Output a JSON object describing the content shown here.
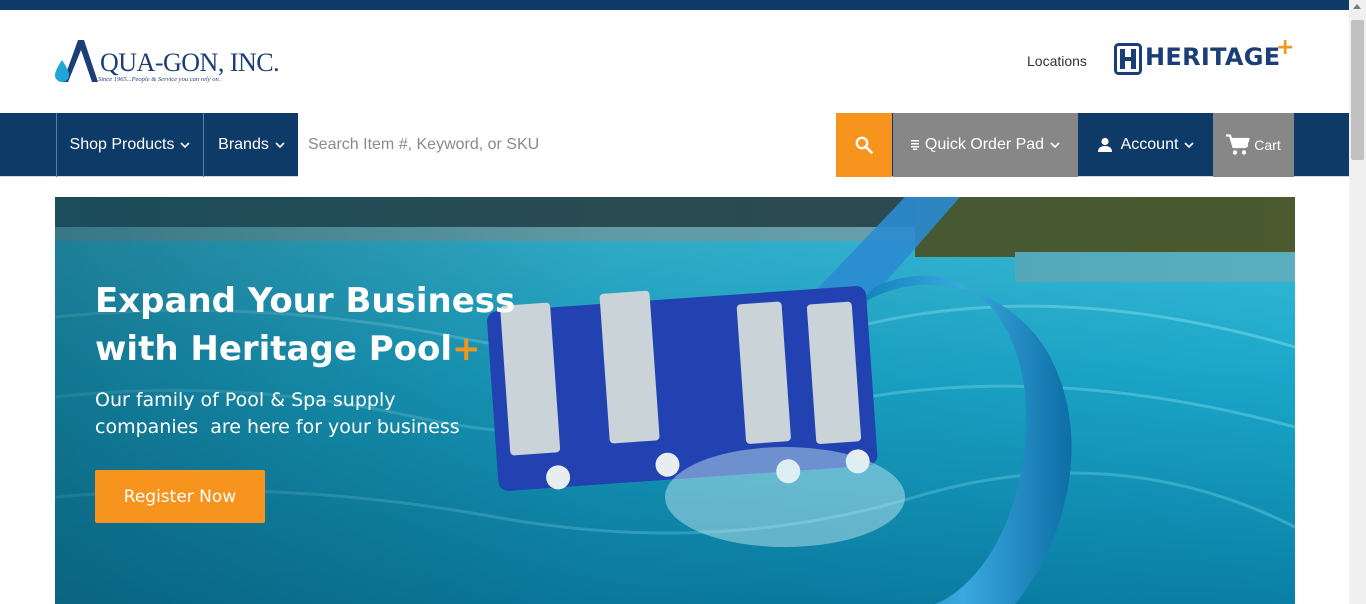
{
  "header": {
    "logo": {
      "name": "AQUA-GON, INC.",
      "name_rest": "QUA-GON, INC.",
      "tagline": "Since 1965...People & Service you can rely on."
    },
    "locations_label": "Locations",
    "heritage_logo": {
      "word": "HERITAGE",
      "plus": "+"
    }
  },
  "nav": {
    "shop_products_label": "Shop Products",
    "brands_label": "Brands",
    "search_placeholder": "Search Item #, Keyword, or SKU",
    "search_value": "",
    "quick_order_label": "Quick Order Pad",
    "account_label": "Account",
    "cart_label": "Cart"
  },
  "hero": {
    "title_line1": "Expand Your Business",
    "title_line2": "with Heritage Pool",
    "title_plus": "+",
    "subtitle_line1": "Our family of Pool & Spa supply",
    "subtitle_line2": "companies  are here for your business",
    "register_label": "Register Now"
  },
  "colors": {
    "navy": "#0d3a66",
    "orange": "#f7941d",
    "gray": "#878787",
    "water": "#1aa6c9"
  },
  "icons": {
    "search": "search-icon",
    "chevron": "chevron-down-icon",
    "quick_order": "list-icon",
    "account": "user-icon",
    "cart": "cart-icon"
  }
}
